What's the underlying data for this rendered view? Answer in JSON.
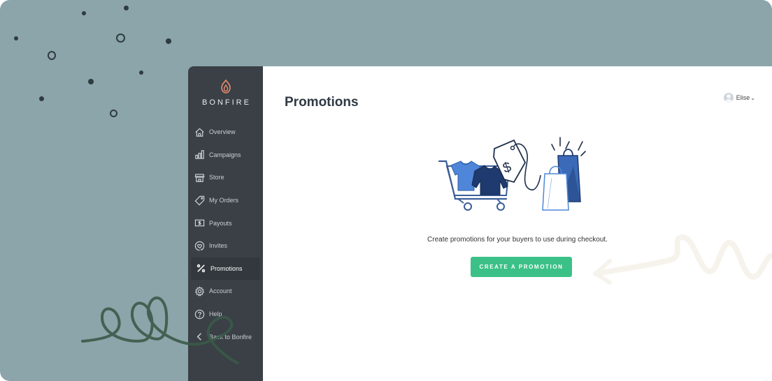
{
  "brand": {
    "name": "BONFIRE",
    "logo_icon": "flame-icon"
  },
  "sidebar": {
    "items": [
      {
        "label": "Overview",
        "icon": "home-icon"
      },
      {
        "label": "Campaigns",
        "icon": "bar-chart-icon"
      },
      {
        "label": "Store",
        "icon": "storefront-icon"
      },
      {
        "label": "My Orders",
        "icon": "tag-icon"
      },
      {
        "label": "Payouts",
        "icon": "payout-icon"
      },
      {
        "label": "Invites",
        "icon": "heart-invite-icon"
      },
      {
        "label": "Promotions",
        "icon": "percent-icon",
        "active": true
      },
      {
        "label": "Account",
        "icon": "gear-icon"
      },
      {
        "label": "Help",
        "icon": "help-icon"
      },
      {
        "label": "Back to Bonfire",
        "icon": "chevron-left-icon"
      }
    ]
  },
  "header": {
    "title": "Promotions"
  },
  "user": {
    "name": "Elise",
    "avatar_icon": "user-avatar-icon"
  },
  "empty_state": {
    "illustration": "shopping-cart-illustration",
    "text": "Create promotions for your buyers to use during checkout.",
    "cta": "CREATE A PROMOTION"
  },
  "colors": {
    "background": "#8ba5aa",
    "sidebar": "#3a4046",
    "accent_green": "#3bc187",
    "brand_orange": "#e98b6b",
    "illustration_blue": "#4f86d9",
    "illustration_navy": "#1f3a6e"
  }
}
